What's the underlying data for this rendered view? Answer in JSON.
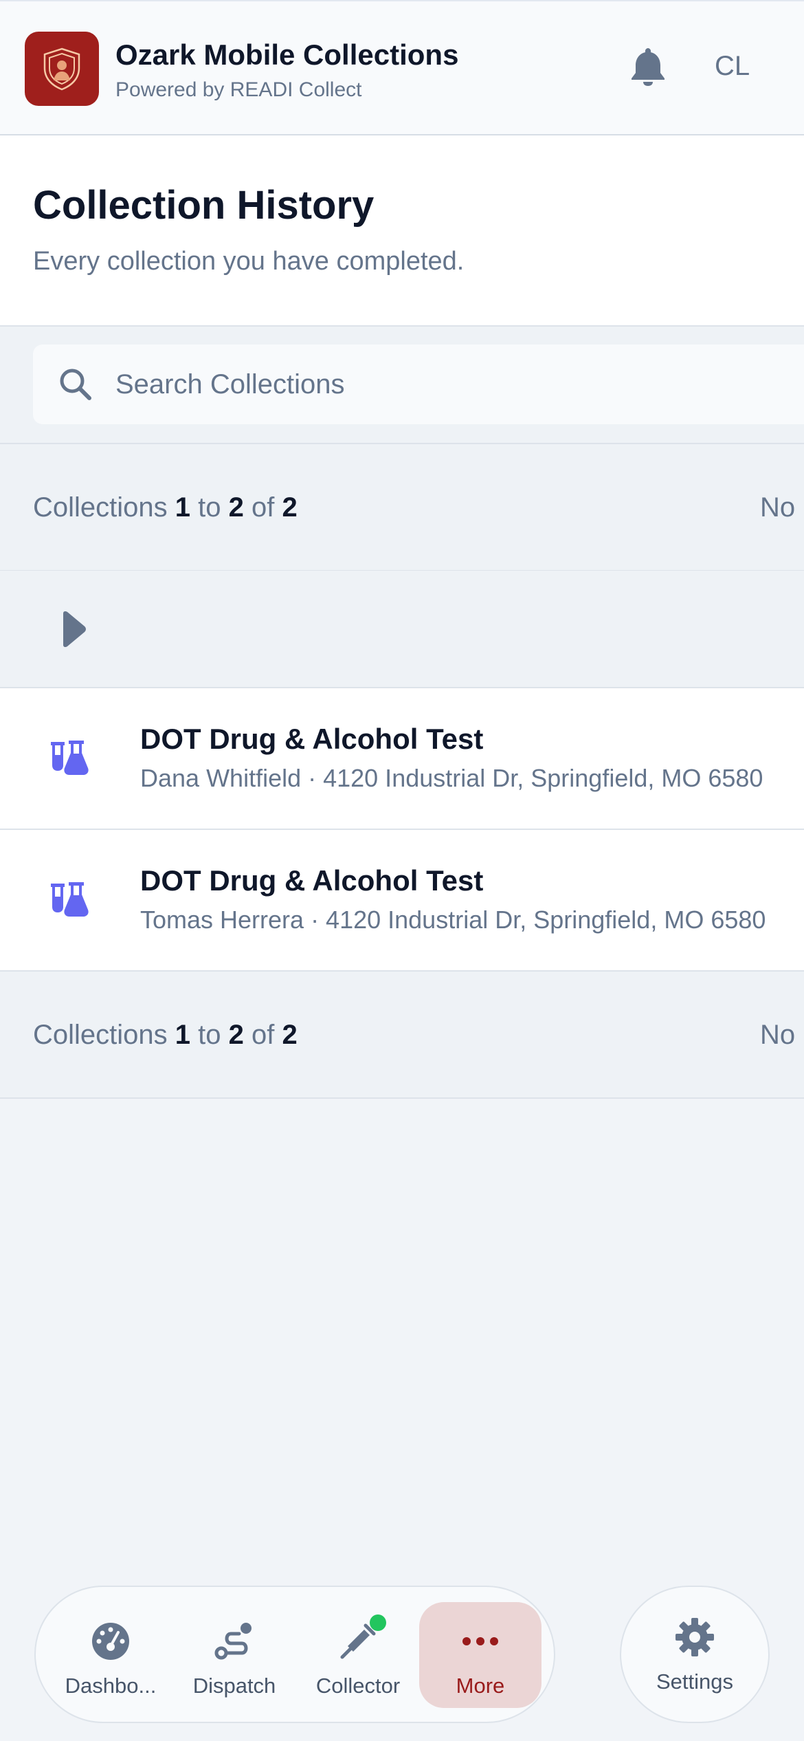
{
  "header": {
    "app_title": "Ozark Mobile Collections",
    "app_subtitle": "Powered by READI Collect",
    "user_initials": "CL",
    "icons": {
      "logo": "shield-person-logo",
      "notifications": "bell-icon"
    }
  },
  "page": {
    "title": "Collection History",
    "subtitle": "Every collection you have completed."
  },
  "search": {
    "placeholder": "Search Collections",
    "value": "",
    "icon": "search-icon"
  },
  "pagination": {
    "prefix": "Collections",
    "start": "1",
    "to_word": "to",
    "end": "2",
    "of_word": "of",
    "total": "2",
    "right_text": "No"
  },
  "expand": {
    "icon": "caret-right-icon"
  },
  "collections": [
    {
      "title": "DOT Drug & Alcohol Test",
      "details": "Dana Whitfield · 4120 Industrial Dr, Springfield, MO 6580",
      "icon": "flask-vials-icon"
    },
    {
      "title": "DOT Drug & Alcohol Test",
      "details": "Tomas Herrera · 4120 Industrial Dr, Springfield, MO 6580",
      "icon": "flask-vials-icon"
    }
  ],
  "nav": {
    "items": [
      {
        "label": "Dashbo...",
        "icon": "gauge-icon"
      },
      {
        "label": "Dispatch",
        "icon": "route-icon"
      },
      {
        "label": "Collector",
        "icon": "syringe-icon",
        "status": "online"
      },
      {
        "label": "More",
        "icon": "ellipsis-icon",
        "active": true
      }
    ],
    "settings": {
      "label": "Settings",
      "icon": "gear-icon"
    }
  },
  "colors": {
    "brand": "#9f1f1c",
    "accent_icon": "#6366f1",
    "active_nav_bg": "#ebd5d5",
    "active_nav_text": "#991b1b",
    "status_online": "#22c55e"
  }
}
